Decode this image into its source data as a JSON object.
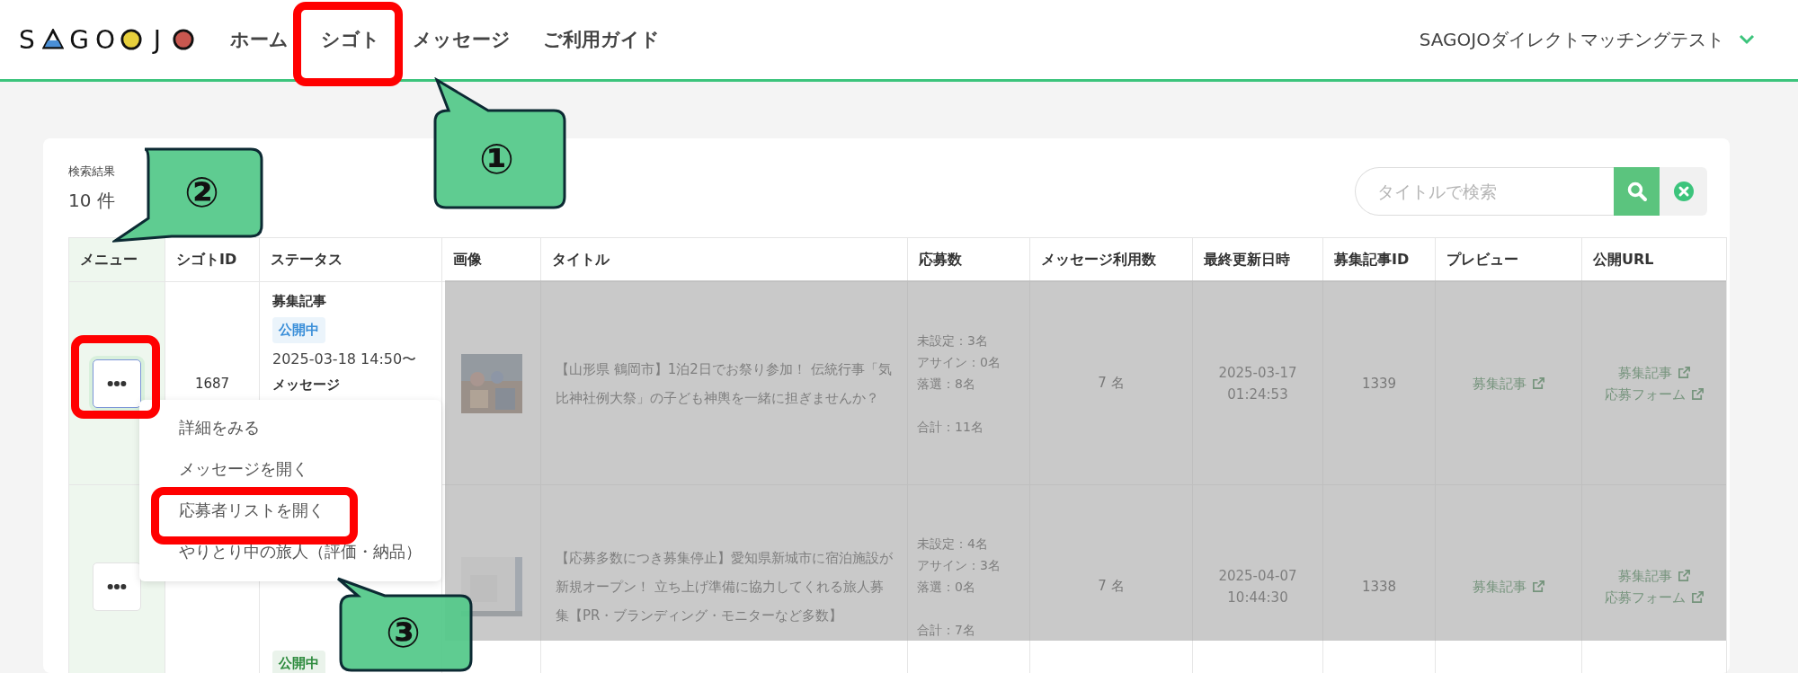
{
  "header": {
    "logo": [
      {
        "kind": "letter",
        "text": "S"
      },
      {
        "kind": "triangle",
        "color": "#4a8fd6"
      },
      {
        "kind": "letter",
        "text": "G"
      },
      {
        "kind": "letter",
        "text": "O"
      },
      {
        "kind": "dot",
        "color": "#e6cf3c"
      },
      {
        "kind": "letter",
        "text": "J"
      },
      {
        "kind": "dot",
        "color": "#c8574f"
      }
    ],
    "nav": [
      "ホーム",
      "シゴト",
      "メッセージ",
      "ご利用ガイド"
    ],
    "account": "SAGOJOダイレクトマッチングテスト"
  },
  "results": {
    "label": "検索結果",
    "count": "10 件"
  },
  "search": {
    "placeholder": "タイトルで検索"
  },
  "table": {
    "columns": [
      "メニュー",
      "シゴトID",
      "ステータス",
      "画像",
      "タイトル",
      "応募数",
      "メッセージ利用数",
      "最終更新日時",
      "募集記事ID",
      "プレビュー",
      "公開URL"
    ],
    "rows": [
      {
        "menu_open": true,
        "menu": [
          "詳細をみる",
          "メッセージを開く",
          "応募者リストを開く",
          "やりとり中の旅人（評価・納品）"
        ],
        "id": "1687",
        "status": [
          {
            "kind": "label",
            "text": "募集記事"
          },
          {
            "kind": "badge",
            "text": "公開中",
            "color": "#3b8fd9"
          },
          {
            "kind": "date",
            "text": "2025-03-18 14:50〜"
          },
          {
            "kind": "label",
            "text": "メッセージ"
          }
        ],
        "image": {
          "kind": "picture"
        },
        "title": "【山形県 鶴岡市】1泊2日でお祭り参加！ 伝統行事「気比神社例大祭」の子ども神輿を一緒に担ぎませんか？",
        "applicants": [
          "未設定：3名",
          "アサイン：0名",
          "落選：8名"
        ],
        "total": "合計：11名",
        "messages": "7 名",
        "updated": [
          "2025-03-17",
          "01:24:53"
        ],
        "article_id": "1339",
        "preview": [
          "募集記事"
        ],
        "public_url": [
          "募集記事",
          "応募フォーム"
        ]
      },
      {
        "menu_open": false,
        "status": [
          {
            "kind": "badge",
            "text": "公開中",
            "color": "#2e8b3e"
          }
        ],
        "image": {
          "kind": "picture"
        },
        "title": "【応募多数につき募集停止】愛知県新城市に宿泊施設が新規オープン！ 立ち上げ準備に協力してくれる旅人募集【PR・ブランディング・モニターなど多数】",
        "applicants": [
          "未設定：4名",
          "アサイン：3名",
          "落選：0名"
        ],
        "total": "合計：7名",
        "messages": "7 名",
        "updated": [
          "2025-04-07",
          "10:44:30"
        ],
        "article_id": "1338",
        "preview": [
          "募集記事"
        ],
        "public_url": [
          "募集記事",
          "応募フォーム"
        ]
      }
    ]
  },
  "callouts": [
    "①",
    "②",
    "③"
  ]
}
